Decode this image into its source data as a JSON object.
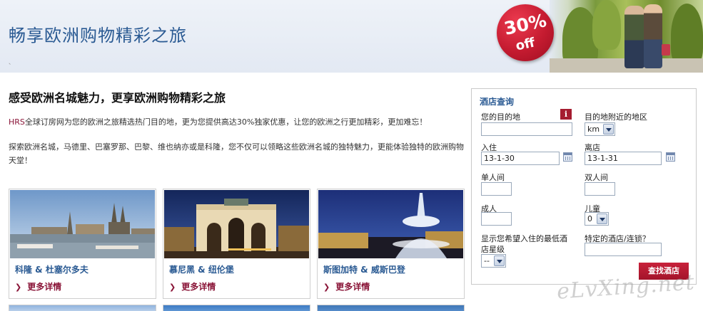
{
  "banner": {
    "title": "畅享欧洲购物精彩之旅",
    "small_mark": "、",
    "promo_percent": "30%",
    "promo_off": "off"
  },
  "intro": {
    "heading": "感受欧洲名城魅力，更享欧洲购物精彩之旅",
    "para1_brand": "HRS",
    "para1_rest": "全球订房网为您的欧洲之旅精选热门目的地，更为您提供高达30%独家优惠，让您的欧洲之行更加精彩，更加难忘！",
    "para2": "探索欧洲名城，马德里、巴塞罗那、巴黎、维也纳亦或是科隆，您不仅可以领略这些欧洲名城的独特魅力，更能体验独特的欧洲购物天堂！"
  },
  "cards": [
    {
      "title": "科隆 & 杜塞尔多夫",
      "more": "更多详情"
    },
    {
      "title": "慕尼黑 & 纽伦堡",
      "more": "更多详情"
    },
    {
      "title": "斯图加特 & 威斯巴登",
      "more": "更多详情"
    }
  ],
  "search": {
    "title": "酒店查询",
    "destination_label": "您的目的地",
    "destination_value": "",
    "nearby_label": "目的地附近的地区",
    "nearby_unit": "km",
    "checkin_label": "入住",
    "checkin_value": "13-1-30",
    "checkout_label": "离店",
    "checkout_value": "13-1-31",
    "single_label": "单人间",
    "double_label": "双人间",
    "adults_label": "成人",
    "children_label": "儿童",
    "children_value": "0",
    "stars_label_1": "显示您希望入住的最低酒",
    "stars_label_2": "店星级",
    "stars_value": "--",
    "chain_label": "特定的酒店/连锁？",
    "button": "查找酒店"
  },
  "watermark": "eLvXing.net",
  "colors": {
    "brand_blue": "#2a5a93",
    "brand_red": "#a51c30",
    "banner_bg": "#e3e9f3"
  },
  "icons": [
    "info-icon",
    "calendar-icon",
    "chevron-right-icon",
    "dropdown-arrow-icon"
  ]
}
